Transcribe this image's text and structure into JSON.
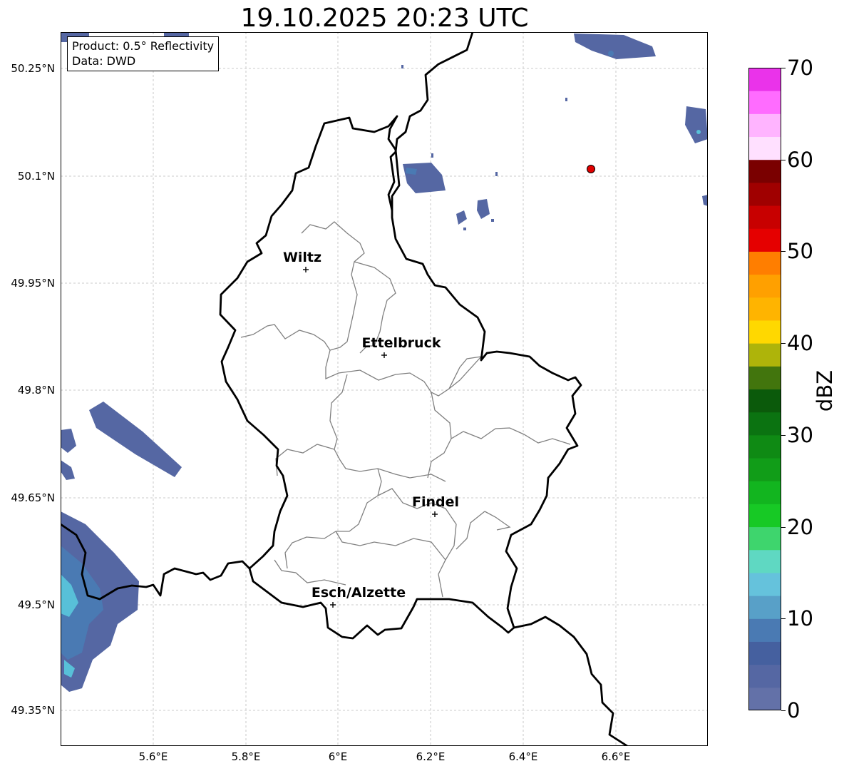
{
  "title": "19.10.2025 20:23 UTC",
  "info": {
    "product": "Product: 0.5° Reflectivity",
    "source": "Data: DWD"
  },
  "axes": {
    "lat_ticks": [
      "50.25°N",
      "50.1°N",
      "49.95°N",
      "49.8°N",
      "49.65°N",
      "49.5°N",
      "49.35°N"
    ],
    "lon_ticks": [
      "5.6°E",
      "5.8°E",
      "6°E",
      "6.2°E",
      "6.4°E",
      "6.6°E"
    ],
    "grid": "dashed"
  },
  "cities": [
    {
      "name": "Wiltz"
    },
    {
      "name": "Ettelbruck"
    },
    {
      "name": "Findel"
    },
    {
      "name": "Esch/Alzette"
    }
  ],
  "marker": {
    "color": "#e00000"
  },
  "colorbar": {
    "label": "dBZ",
    "ticks": [
      "0",
      "10",
      "20",
      "30",
      "40",
      "50",
      "60",
      "70"
    ],
    "min": 0,
    "max": 70,
    "colors": [
      "#6371a8",
      "#5567a3",
      "#45609f",
      "#4a7ab3",
      "#58a0c8",
      "#65c2dc",
      "#5fd8c2",
      "#3ed56d",
      "#17c925",
      "#12b51f",
      "#119d18",
      "#0f8a14",
      "#0b7311",
      "#0b5a0b",
      "#42750d",
      "#aeb40a",
      "#ffd800",
      "#ffb400",
      "#ffa000",
      "#ff7e00",
      "#e50000",
      "#c80000",
      "#a00000",
      "#7a0000",
      "#ffe0ff",
      "#ffb4ff",
      "#ff6cff",
      "#ea33ea"
    ]
  },
  "colors": {
    "country_border": "#000000",
    "canton_border": "#808080",
    "grid": "#bbbbbb",
    "precip_low": "#5567a3",
    "precip_mid": "#4a7ab3",
    "precip_high": "#58c0d8"
  }
}
